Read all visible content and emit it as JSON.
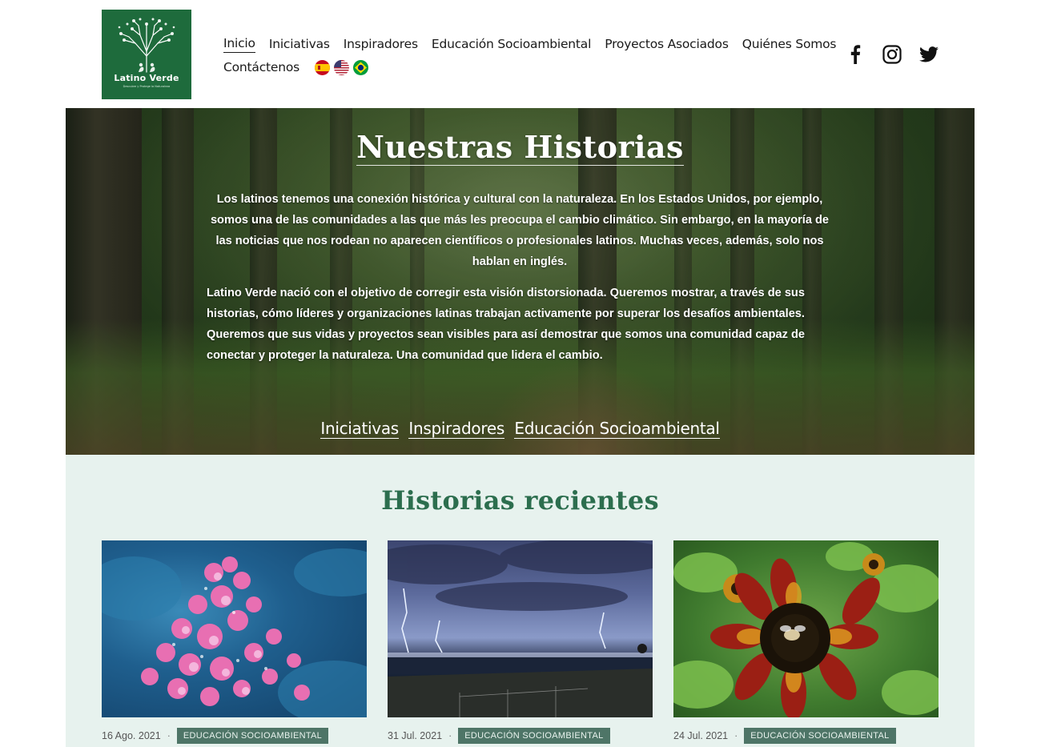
{
  "brand": {
    "name": "Latino Verde",
    "tagline": "Descubre y Protege la Naturaleza",
    "logo_color": "#1e6b3c"
  },
  "nav": {
    "items": [
      {
        "label": "Inicio",
        "active": true
      },
      {
        "label": "Iniciativas"
      },
      {
        "label": "Inspiradores"
      },
      {
        "label": "Educación Socioambiental"
      },
      {
        "label": "Proyectos Asociados"
      },
      {
        "label": "Quiénes Somos"
      },
      {
        "label": "Contáctenos"
      }
    ],
    "flags": [
      "spain-flag-icon",
      "usa-flag-icon",
      "brazil-flag-icon"
    ]
  },
  "social": [
    "facebook-icon",
    "instagram-icon",
    "twitter-icon"
  ],
  "hero": {
    "title": "Nuestras Historias",
    "paragraph1": "Los latinos tenemos una conexión histórica y cultural con la naturaleza. En los Estados Unidos, por ejemplo, somos una de las comunidades a las que más les preocupa el cambio climático. Sin embargo, en la mayoría de las noticias que nos rodean no aparecen científicos o profesionales latinos. Muchas veces, además, solo nos hablan en inglés.",
    "paragraph2": "Latino Verde nació con el objetivo de corregir esta visión distorsionada. Queremos mostrar, a través de sus historias, cómo líderes y organizaciones latinas trabajan activamente por superar los desafíos ambientales. Queremos que sus vidas y proyectos sean visibles para así demostrar que somos una comunidad capaz de conectar y proteger la naturaleza. Una comunidad que lidera el cambio.",
    "links": [
      "Iniciativas",
      "Inspiradores",
      "Educación Socioambiental"
    ]
  },
  "recent": {
    "title": "Historias recientes",
    "accent": "#2c6e4e",
    "cards": [
      {
        "date": "16 Ago. 2021",
        "tag": "EDUCACIÓN SOCIOAMBIENTAL",
        "image": "coral"
      },
      {
        "date": "31 Jul. 2021",
        "tag": "EDUCACIÓN SOCIOAMBIENTAL",
        "image": "storm"
      },
      {
        "date": "24 Jul. 2021",
        "tag": "EDUCACIÓN SOCIOAMBIENTAL",
        "image": "sunflower"
      }
    ]
  }
}
